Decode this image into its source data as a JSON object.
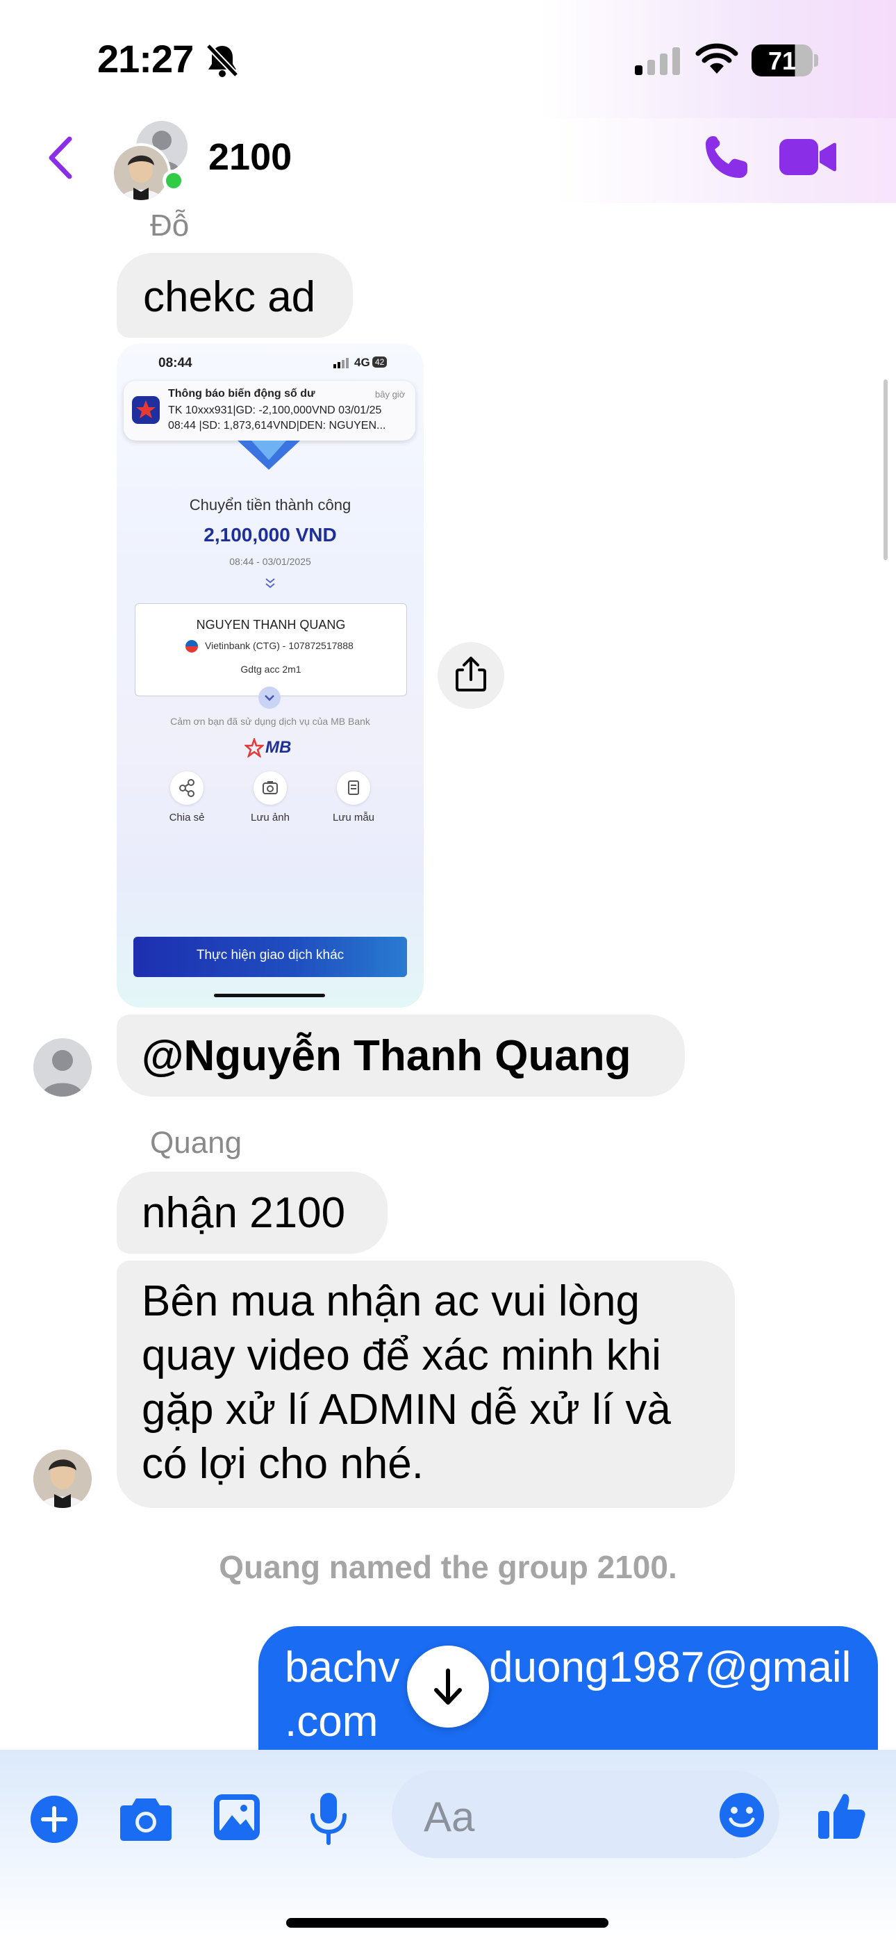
{
  "status": {
    "time": "21:27",
    "battery": "71"
  },
  "header": {
    "title": "2100"
  },
  "messages": {
    "sender1": "Đỗ",
    "msg1": "chekc ad",
    "mention": "@Nguyễn Thanh Quang",
    "sender2": "Quang",
    "msg2": "nhận 2100",
    "msg3": "Bên mua nhận ac vui lòng quay video để xác minh khi gặp xử lí ADMIN dễ xử lí và có lợi cho nhé.",
    "system": "Quang named the group 2100.",
    "outgoing": "bachvanduong1987@gmail.com",
    "outgoing_line1": "bachv",
    "outgoing_line1b": "duong1987@gmail",
    "outgoing_line2": ".com"
  },
  "receipt": {
    "time": "08:44",
    "network": "4G",
    "network_badge": "42",
    "notif_title": "Thông báo biến động số dư",
    "notif_when": "bây giờ",
    "notif_line1": "TK 10xxx931|GD: -2,100,000VND 03/01/25",
    "notif_line2": "08:44 |SD: 1,873,614VND|DEN: NGUYEN...",
    "success": "Chuyển tiền thành công",
    "amount": "2,100,000 VND",
    "datetime": "08:44 - 03/01/2025",
    "recipient": "NGUYEN THANH QUANG",
    "bank": "Vietinbank (CTG) - 107872517888",
    "note": "Gdtg acc 2m1",
    "thanks": "Cảm ơn bạn đã sử dụng dịch vụ của MB Bank",
    "brand": "MB",
    "action_share": "Chia sẻ",
    "action_save_image": "Lưu ảnh",
    "action_save_template": "Lưu mẫu",
    "cta": "Thực hiện giao dịch khác"
  },
  "composer": {
    "placeholder": "Aa"
  },
  "colors": {
    "accent_purple": "#8a2ee8",
    "messenger_blue": "#1a6cf2",
    "mb_navy": "#1e2f9a"
  }
}
